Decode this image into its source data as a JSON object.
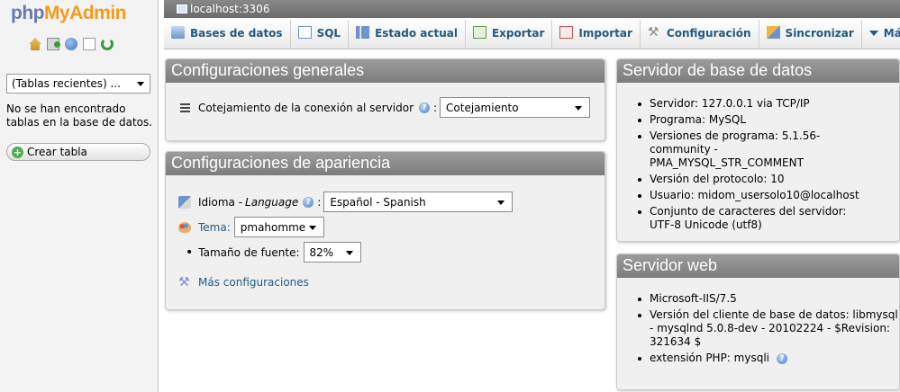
{
  "nav": {
    "logo": {
      "php": "php",
      "my": "My",
      "admin": "Admin"
    },
    "icons": [
      "home-icon",
      "exit-icon",
      "help-icon",
      "docs-icon",
      "reload-icon"
    ],
    "recent_select": "(Tablas recientes) ...",
    "no_tables": "No se han encontrado tablas en la base de datos.",
    "create_table": "Crear tabla"
  },
  "server_bar": {
    "label": "localhost:3306"
  },
  "tabs": [
    {
      "label": "Bases de datos",
      "icon": "databases-icon"
    },
    {
      "label": "SQL",
      "icon": "sql-icon"
    },
    {
      "label": "Estado actual",
      "icon": "status-icon"
    },
    {
      "label": "Exportar",
      "icon": "export-icon"
    },
    {
      "label": "Importar",
      "icon": "import-icon"
    },
    {
      "label": "Configuración",
      "icon": "settings-icon"
    },
    {
      "label": "Sincronizar",
      "icon": "sync-icon"
    },
    {
      "label": "Más",
      "icon": "chevron-down-icon"
    }
  ],
  "general": {
    "title": "Configuraciones generales",
    "collation_label": "Cotejamiento de la conexión al servidor",
    "collation_colon": ":",
    "collation_value": "Cotejamiento"
  },
  "appearance": {
    "title": "Configuraciones de apariencia",
    "language_label": "Idioma - ",
    "language_en": "Language",
    "language_colon": ":",
    "language_value": "Español - Spanish",
    "theme_label": "Tema:",
    "theme_value": "pmahomme",
    "font_label": "Tamaño de fuente:",
    "font_value": "82%",
    "more_settings": "Más configuraciones"
  },
  "db_server": {
    "title": "Servidor de base de datos",
    "items": [
      "Servidor: 127.0.0.1 via TCP/IP",
      "Programa: MySQL",
      "Versiones de programa: 5.1.56-community - PMA_MYSQL_STR_COMMENT",
      "Versión del protocolo: 10",
      "Usuario: midom_usersolo10@localhost",
      "Conjunto de caracteres del servidor: UTF-8 Unicode (utf8)"
    ]
  },
  "web_server": {
    "title": "Servidor web",
    "items": [
      "Microsoft-IIS/7.5",
      "Versión del cliente de base de datos: libmysql - mysqlnd 5.0.8-dev - 20102224 - $Revision: 321634 $",
      "extensión PHP: mysqli"
    ]
  }
}
